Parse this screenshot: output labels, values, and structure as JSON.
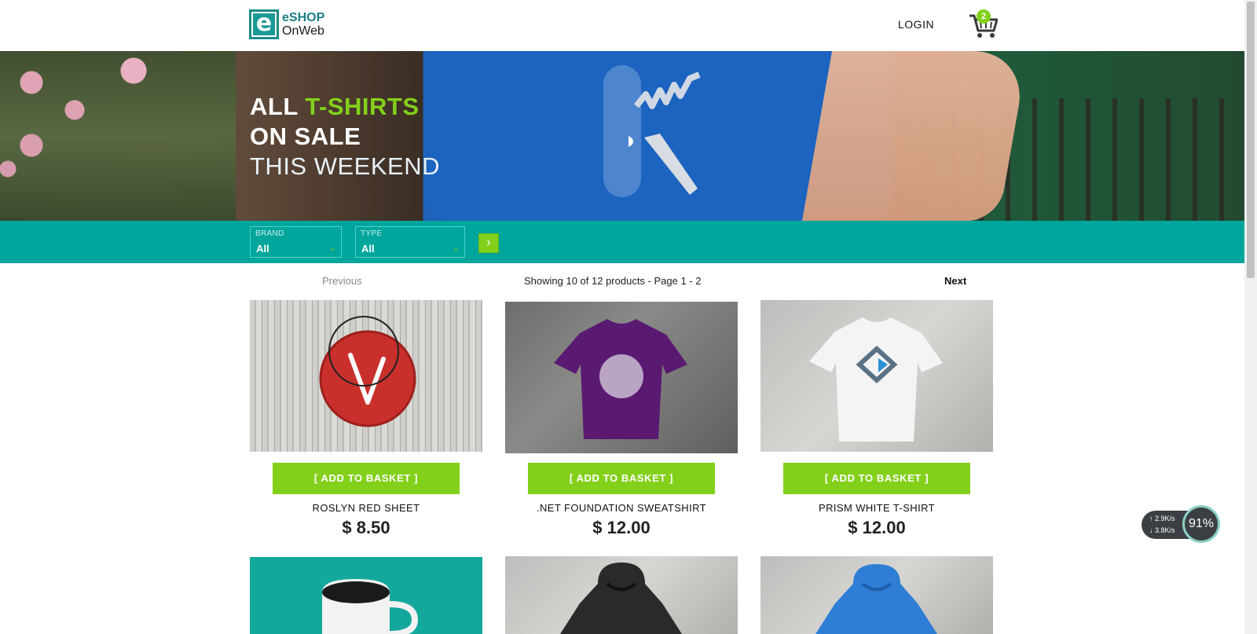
{
  "header": {
    "logo_line1": "eSHOP",
    "logo_line2": "OnWeb",
    "logo_letter": "e",
    "login": "LOGIN",
    "cart_count": "2"
  },
  "hero": {
    "line1_a": "ALL ",
    "line1_b": "T-SHIRTS",
    "line2": "ON SALE",
    "line3": "THIS WEEKEND"
  },
  "filters": {
    "brand_label": "BRAND",
    "brand_value": "All",
    "type_label": "TYPE",
    "type_value": "All",
    "go_glyph": "›"
  },
  "pager": {
    "previous": "Previous",
    "info": "Showing 10 of 12 products - Page 1 - 2",
    "next": "Next"
  },
  "products": [
    {
      "name": "ROSLYN RED SHEET",
      "price": "$ 8.50",
      "button": "[ ADD TO BASKET ]"
    },
    {
      "name": ".NET FOUNDATION SWEATSHIRT",
      "price": "$ 12.00",
      "button": "[ ADD TO BASKET ]"
    },
    {
      "name": "PRISM WHITE T-SHIRT",
      "price": "$ 12.00",
      "button": "[ ADD TO BASKET ]"
    }
  ],
  "speed_widget": {
    "up": "↑ 2.9K/s",
    "down": "↓ 3.8K/s",
    "percent": "91%"
  },
  "colors": {
    "accent_green": "#83d01b",
    "teal": "#00a69c"
  }
}
